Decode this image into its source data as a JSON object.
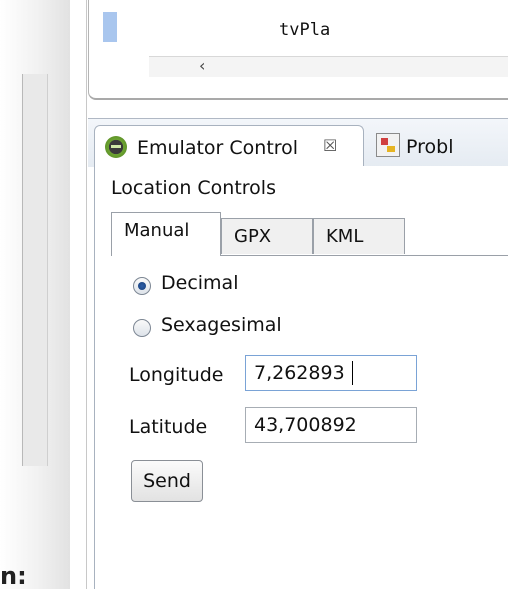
{
  "editor": {
    "code_fragment": "tvPla",
    "scroll_left_arrow": "‹"
  },
  "view_tabs": [
    {
      "label": "Emulator Control",
      "close": "☒",
      "icon": "android-emulator-icon"
    },
    {
      "label": "Probl",
      "icon": "problems-icon"
    }
  ],
  "location_controls": {
    "title": "Location Controls",
    "tabs": [
      "Manual",
      "GPX",
      "KML"
    ],
    "active_tab": "Manual",
    "radio_decimal": "Decimal",
    "radio_sexagesimal": "Sexagesimal",
    "selected_format": "Decimal",
    "longitude_label": "Longitude",
    "longitude_value": "7,262893",
    "latitude_label": "Latitude",
    "latitude_value": "43,700892",
    "send_label": "Send"
  },
  "background_fragment": "n:",
  "colors": {
    "radio_selected": "#2e5fa8",
    "tab_bar": "#e5ebf2",
    "code_highlight": "#a9c6ee"
  }
}
